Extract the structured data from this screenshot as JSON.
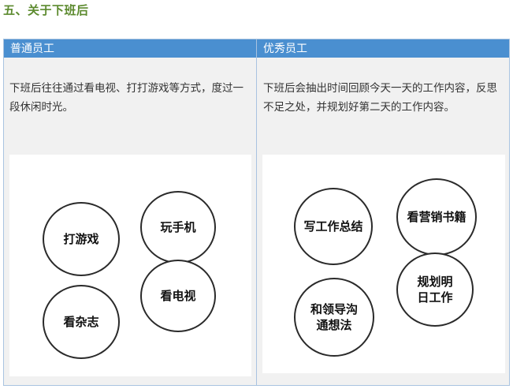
{
  "section": {
    "title": "五、关于下班后"
  },
  "columns": [
    {
      "header": "普通员工",
      "text": "下班后往往通过看电视、打打游戏等方式，度过一段休闲时光。",
      "bubbles": [
        "打游戏",
        "玩手机",
        "看电视",
        "看杂志"
      ]
    },
    {
      "header": "优秀员工",
      "text": "下班后会抽出时间回顾今天一天的工作内容，反思不足之处，并规划好第二天的工作内容。",
      "bubbles": [
        "写工作总结",
        "看营销书籍",
        "和领导沟通想法",
        "规划明日工作"
      ]
    }
  ]
}
